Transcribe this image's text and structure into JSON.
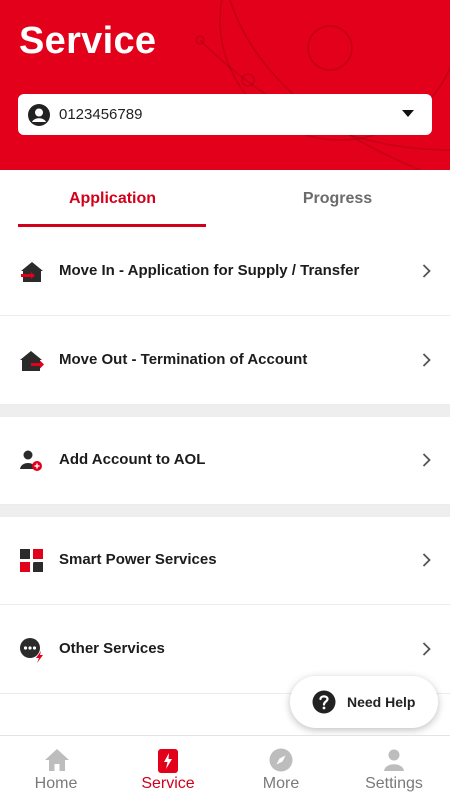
{
  "header": {
    "title": "Service",
    "account_number": "0123456789",
    "accent_color": "#e2001a"
  },
  "tabs": [
    {
      "label": "Application",
      "active": true
    },
    {
      "label": "Progress",
      "active": false
    }
  ],
  "services": [
    {
      "label": "Move In - Application for Supply / Transfer",
      "icon": "move-in-house-icon"
    },
    {
      "label": "Move Out - Termination of Account",
      "icon": "move-out-house-icon"
    },
    {
      "label": "Add Account to AOL",
      "icon": "add-account-icon"
    },
    {
      "label": "Smart Power Services",
      "icon": "smart-power-icon"
    },
    {
      "label": "Other Services",
      "icon": "other-services-icon"
    }
  ],
  "help": {
    "label": "Need Help"
  },
  "bottom_nav": [
    {
      "label": "Home",
      "icon": "home-icon",
      "active": false
    },
    {
      "label": "Service",
      "icon": "service-icon",
      "active": true
    },
    {
      "label": "More",
      "icon": "compass-icon",
      "active": false
    },
    {
      "label": "Settings",
      "icon": "person-icon",
      "active": false
    }
  ]
}
